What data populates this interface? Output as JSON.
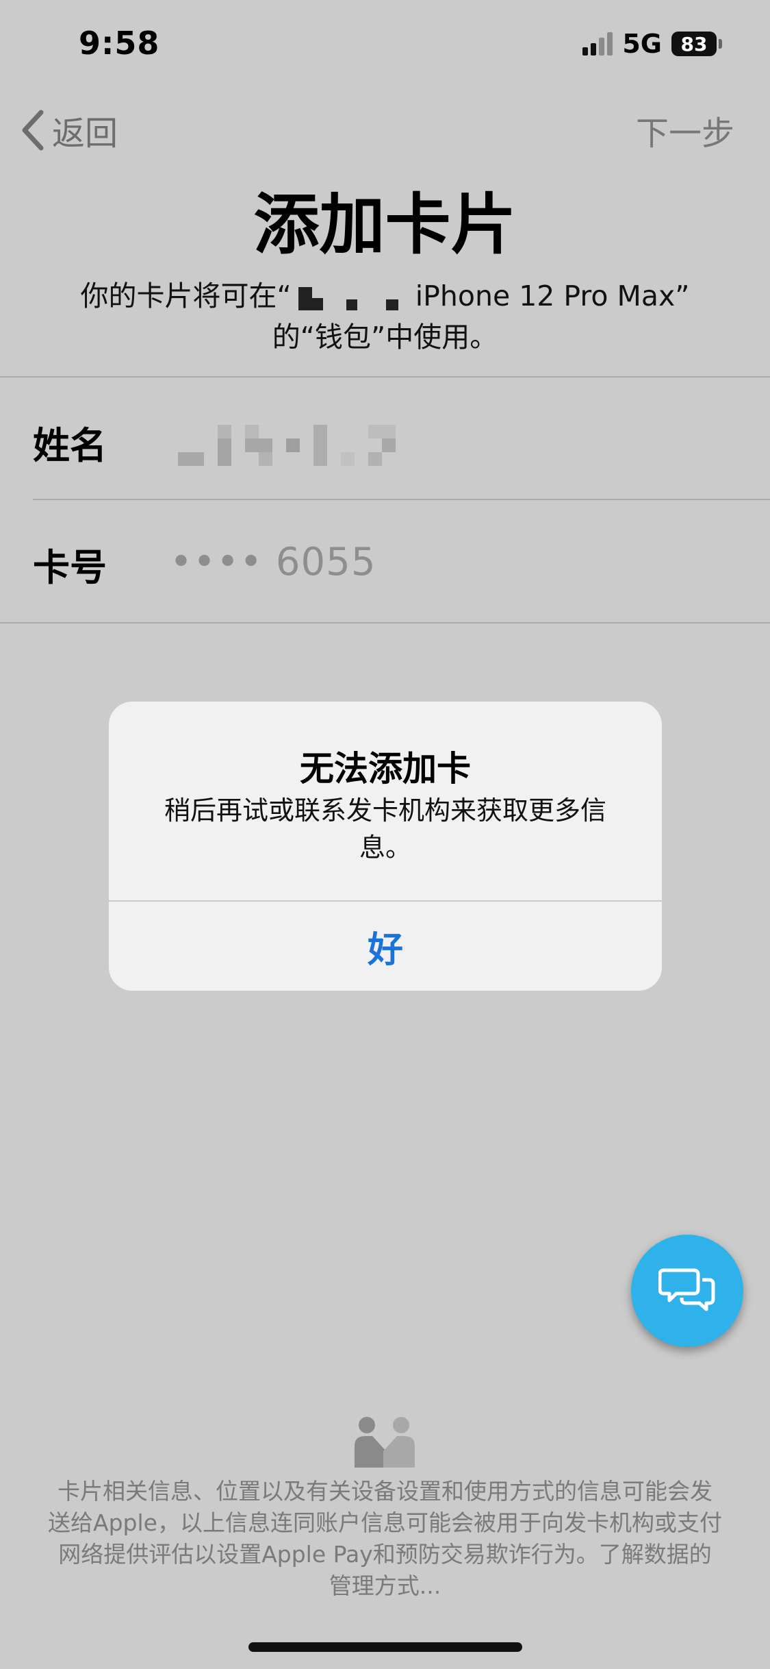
{
  "status_bar": {
    "time": "9:58",
    "network": "5G",
    "battery": "83"
  },
  "nav": {
    "back_label": "返回",
    "next_label": "下一步"
  },
  "title": "添加卡片",
  "subtitle": {
    "line1_prefix": "你的卡片将可在“",
    "line1_suffix": " iPhone 12 Pro Max”",
    "line2": "的“钱包”中使用。"
  },
  "form": {
    "name_label": "姓名",
    "card_label": "卡号",
    "card_value": "•••• 6055"
  },
  "alert": {
    "title": "无法添加卡",
    "message": "稍后再试或联系发卡机构来获取更多信息。",
    "ok_label": "好"
  },
  "footer": {
    "text": "卡片相关信息、位置以及有关设备设置和使用方式的信息可能会发送给Apple，以上信息连同账户信息可能会被用于向发卡机构或支付网络提供评估以设置Apple Pay和预防交易欺诈行为。了解数据的管理方式..."
  },
  "colors": {
    "background": "#cbcbcb",
    "alert_background": "#f1f1f1",
    "ok_blue": "#1a73d9",
    "chat_fab": "#2fb1ea"
  },
  "icons": {
    "back": "chevron-left-icon",
    "chat": "chat-bubbles-icon",
    "privacy": "handshake-people-icon",
    "signal": "cellular-signal-icon",
    "battery": "battery-icon"
  }
}
